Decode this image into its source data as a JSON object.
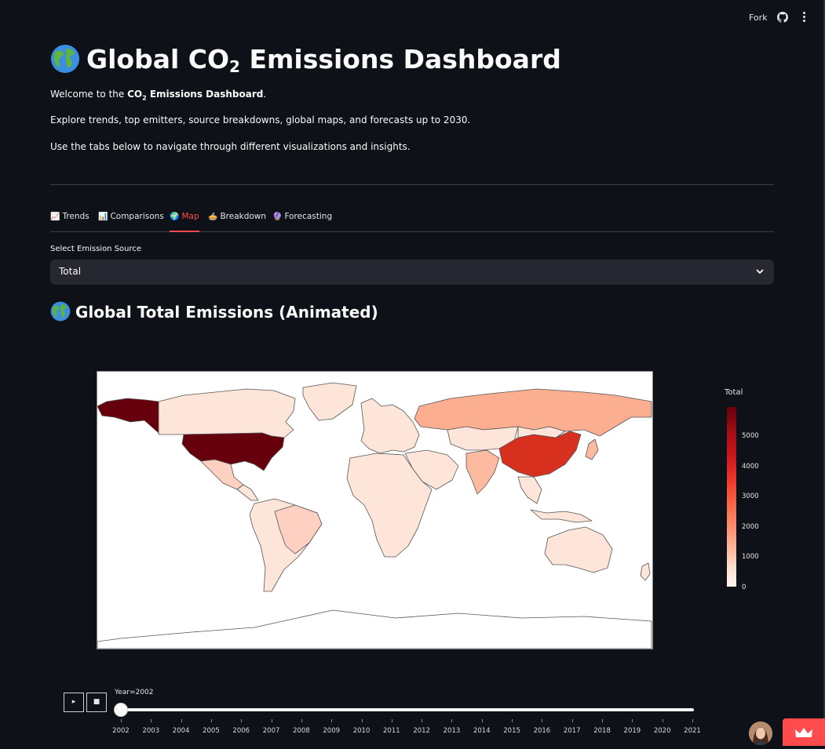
{
  "header": {
    "fork_label": "Fork",
    "github_icon": "github-icon",
    "menu_icon": "kebab-menu-icon"
  },
  "page": {
    "title_prefix": "Global CO",
    "title_sub": "2",
    "title_suffix": " Emissions Dashboard",
    "welcome_prefix": "Welcome to the ",
    "welcome_bold_prefix": "CO",
    "welcome_bold_sub": "2",
    "welcome_bold_suffix": " Emissions Dashboard",
    "welcome_suffix": ".",
    "explore_text": "Explore trends, top emitters, source breakdowns, global maps, and forecasts up to 2030.",
    "tabs_hint": "Use the tabs below to navigate through different visualizations and insights."
  },
  "tabs": [
    {
      "icon": "📈",
      "label": "Trends",
      "active": false
    },
    {
      "icon": "📊",
      "label": "Comparisons",
      "active": false
    },
    {
      "icon": "🌍",
      "label": "Map",
      "active": true
    },
    {
      "icon": "🥧",
      "label": "Breakdown",
      "active": false
    },
    {
      "icon": "🔮",
      "label": "Forecasting",
      "active": false
    }
  ],
  "select": {
    "label": "Select Emission Source",
    "value": "Total"
  },
  "section_title": "Global Total Emissions (Animated)",
  "colorbar": {
    "title": "Total",
    "ticks": [
      "5000",
      "4000",
      "3000",
      "2000",
      "1000",
      "0"
    ],
    "range": [
      0,
      5900
    ]
  },
  "animation": {
    "play_symbol": "▸",
    "stop_symbol": "■",
    "current_label": "Year=2002",
    "current_year": 2002,
    "years": [
      "2002",
      "2003",
      "2004",
      "2005",
      "2006",
      "2007",
      "2008",
      "2009",
      "2010",
      "2011",
      "2012",
      "2013",
      "2014",
      "2015",
      "2016",
      "2017",
      "2018",
      "2019",
      "2020",
      "2021"
    ]
  },
  "colors": {
    "background": "#0e1117",
    "accent": "#ff4b4b",
    "high": "#67000d",
    "china": "#d7301f",
    "russia": "#fcae91",
    "low": "#fee5d9"
  }
}
